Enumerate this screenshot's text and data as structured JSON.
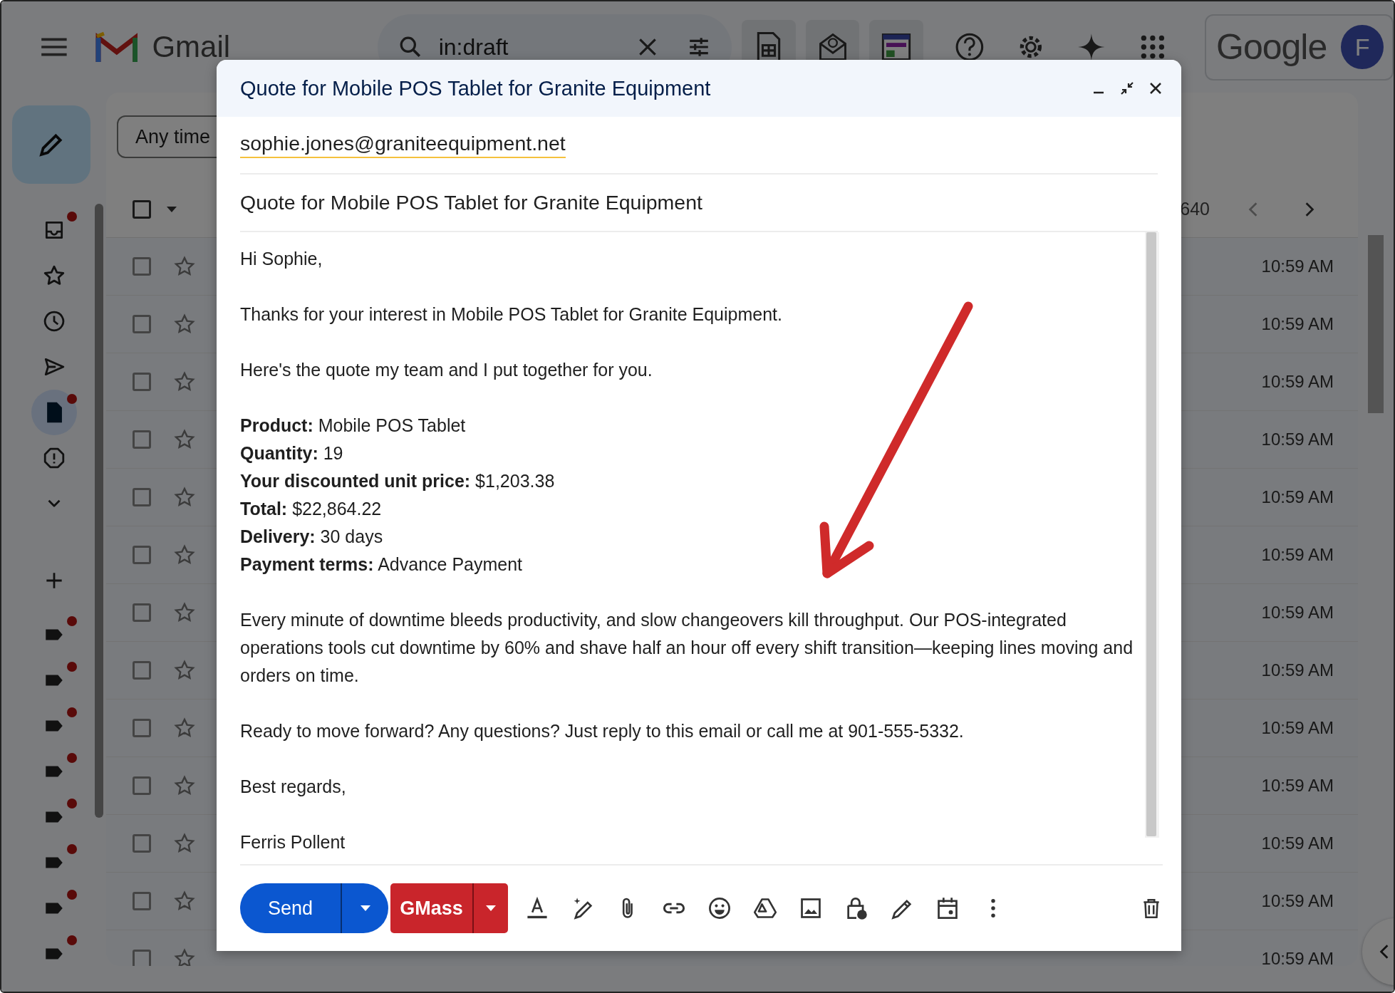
{
  "header": {
    "app_name": "Gmail",
    "search": {
      "value": "in:draft"
    },
    "brand": "Google",
    "avatar_letter": "F"
  },
  "sidebar": {
    "items": [
      {
        "kind": "inbox",
        "selected": false,
        "notification": true
      },
      {
        "kind": "starred",
        "selected": false,
        "notification": false
      },
      {
        "kind": "snoozed",
        "selected": false,
        "notification": false
      },
      {
        "kind": "sent",
        "selected": false,
        "notification": false
      },
      {
        "kind": "drafts",
        "selected": true,
        "notification": true
      },
      {
        "kind": "spam",
        "selected": false,
        "notification": false
      },
      {
        "kind": "more",
        "selected": false,
        "notification": false
      },
      {
        "kind": "create-label",
        "selected": false,
        "notification": false
      },
      {
        "kind": "label",
        "selected": false,
        "notification": true
      },
      {
        "kind": "label",
        "selected": false,
        "notification": true
      },
      {
        "kind": "label",
        "selected": false,
        "notification": true
      },
      {
        "kind": "label",
        "selected": false,
        "notification": true
      },
      {
        "kind": "label",
        "selected": false,
        "notification": true
      },
      {
        "kind": "label",
        "selected": false,
        "notification": true
      },
      {
        "kind": "label",
        "selected": false,
        "notification": true
      },
      {
        "kind": "label",
        "selected": false,
        "notification": true
      }
    ]
  },
  "filters": [
    {
      "label": "Any time"
    }
  ],
  "list": {
    "select_all": {
      "checked": false
    },
    "pagination": "640",
    "rows": [
      {
        "checked": false,
        "time": "10:59 AM"
      },
      {
        "checked": false,
        "time": "10:59 AM"
      },
      {
        "checked": false,
        "time": "10:59 AM"
      },
      {
        "checked": false,
        "time": "10:59 AM"
      },
      {
        "checked": false,
        "time": "10:59 AM"
      },
      {
        "checked": false,
        "time": "10:59 AM"
      },
      {
        "checked": false,
        "time": "10:59 AM"
      },
      {
        "checked": false,
        "time": "10:59 AM"
      },
      {
        "checked": false,
        "time": "10:59 AM"
      },
      {
        "checked": false,
        "time": "10:59 AM"
      },
      {
        "checked": false,
        "time": "10:59 AM"
      },
      {
        "checked": false,
        "time": "10:59 AM"
      },
      {
        "checked": false,
        "time": "10:59 AM"
      }
    ]
  },
  "compose": {
    "title": "Quote for Mobile POS Tablet for Granite Equipment",
    "to": "sophie.jones@graniteequipment.net",
    "subject": "Quote for Mobile POS Tablet for Granite Equipment",
    "body": [
      {
        "lines": [
          "Hi Sophie,"
        ]
      },
      {
        "lines": [
          "Thanks for your interest in Mobile POS Tablet for Granite Equipment."
        ]
      },
      {
        "lines": [
          "Here's the quote my team and I put together for you."
        ]
      },
      {
        "lines": [
          "**Product:** Mobile POS Tablet",
          "**Quantity:** 19",
          "**Your discounted unit price:** $1,203.38",
          "**Total:** $22,864.22",
          "**Delivery:** 30 days",
          "**Payment terms:** Advance Payment"
        ]
      },
      {
        "lines": [
          "Every minute of downtime bleeds productivity, and slow changeovers kill throughput. Our POS-integrated operations tools cut downtime by 60% and shave half an hour off every shift transition—keeping lines moving and orders on time."
        ]
      },
      {
        "lines": [
          "Ready to move forward? Any questions? Just reply to this email or call me at 901-555-5332."
        ]
      },
      {
        "lines": [
          "Best regards,"
        ]
      },
      {
        "lines": [
          "Ferris Pollent"
        ]
      }
    ],
    "send_label": "Send",
    "gmass_label": "GMass"
  }
}
